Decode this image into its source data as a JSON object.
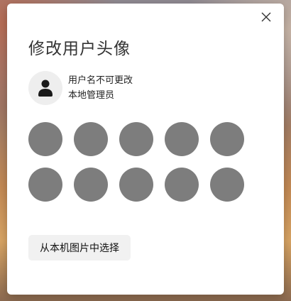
{
  "dialog": {
    "title": "修改用户头像",
    "close_icon": "close-icon"
  },
  "user": {
    "avatar_icon": "user-icon",
    "name": "用户名不可更改",
    "role": "本地管理员"
  },
  "avatar_options": [
    {
      "name": "avatar-option-1"
    },
    {
      "name": "avatar-option-2"
    },
    {
      "name": "avatar-option-3"
    },
    {
      "name": "avatar-option-4"
    },
    {
      "name": "avatar-option-5"
    },
    {
      "name": "avatar-option-6"
    },
    {
      "name": "avatar-option-7"
    },
    {
      "name": "avatar-option-8"
    },
    {
      "name": "avatar-option-9"
    },
    {
      "name": "avatar-option-10"
    }
  ],
  "choose_button": {
    "label": "从本机图片中选择"
  },
  "colors": {
    "avatar_placeholder": "#7d7d7d",
    "dialog_background": "#ffffff",
    "button_background": "#f1f1f1"
  }
}
